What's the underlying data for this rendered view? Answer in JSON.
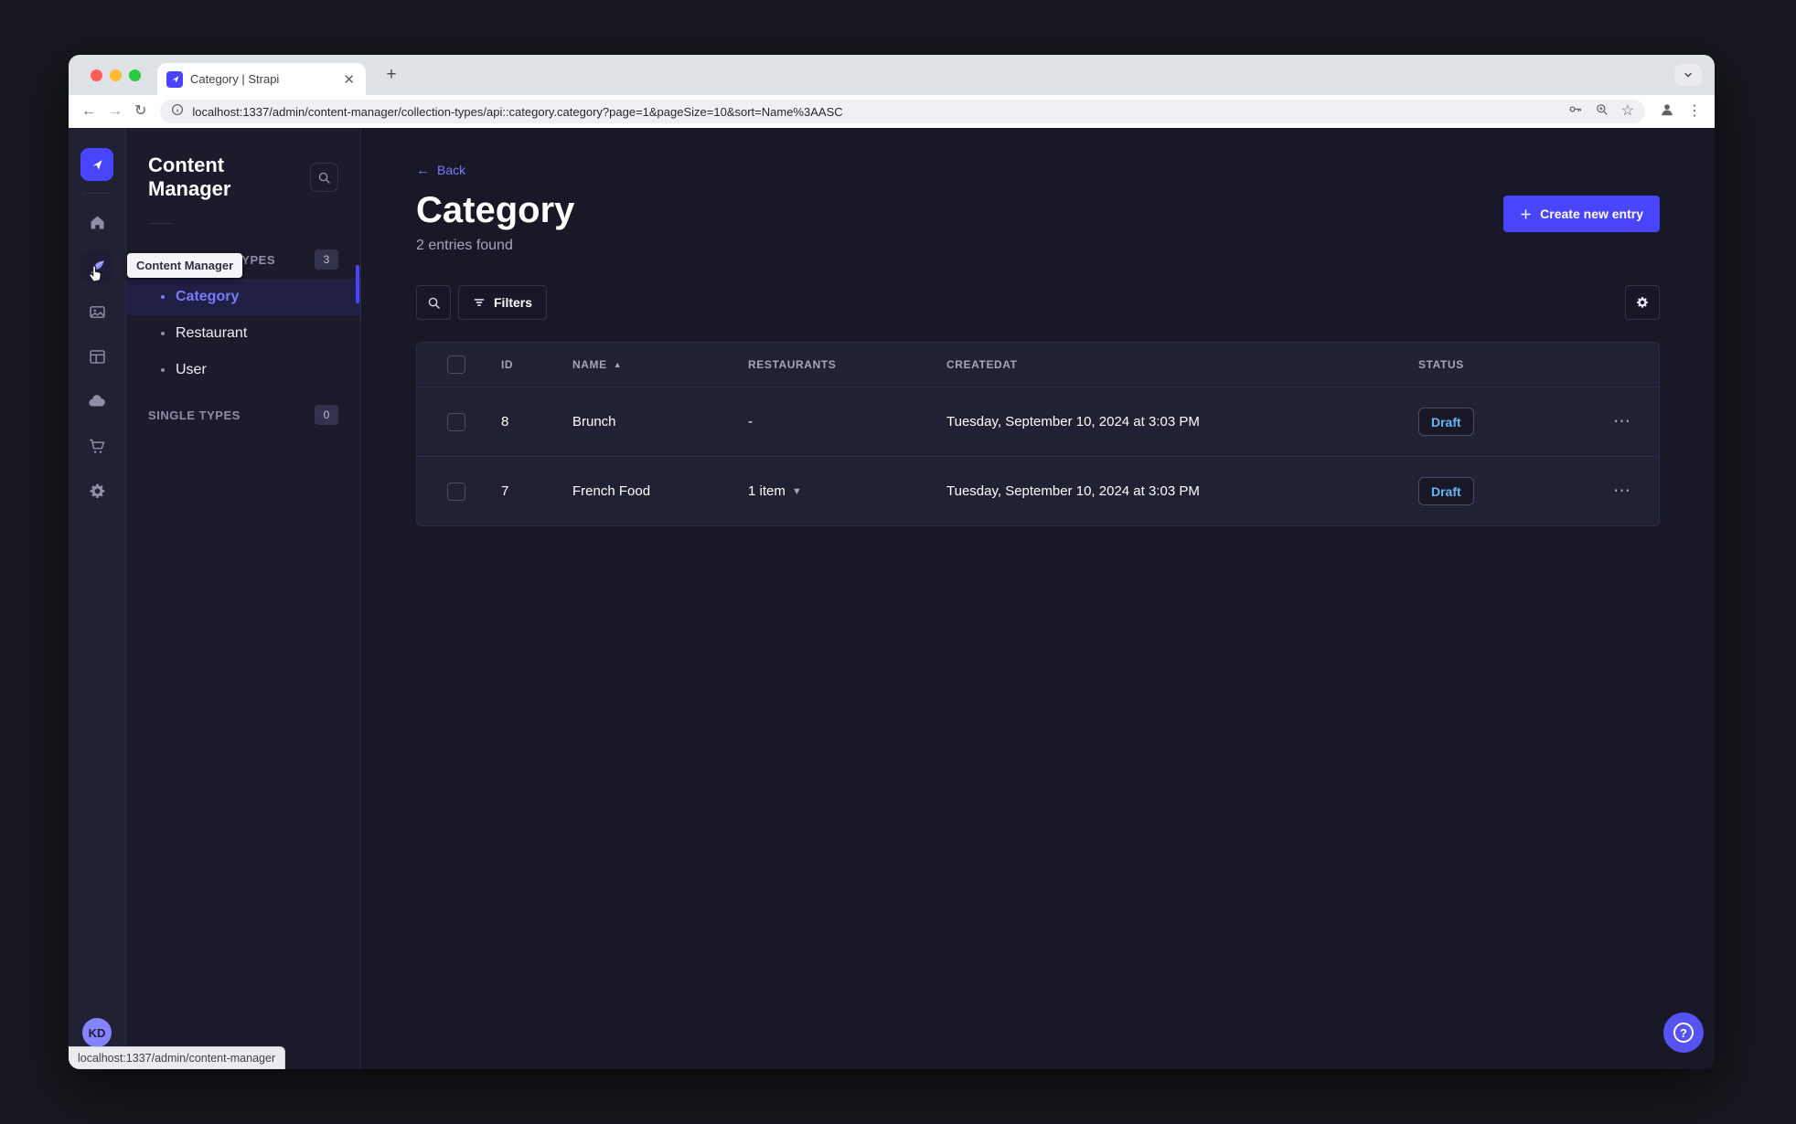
{
  "browser": {
    "tab_title": "Category | Strapi",
    "url": "localhost:1337/admin/content-manager/collection-types/api::category.category?page=1&pageSize=10&sort=Name%3AASC",
    "status_tooltip": "localhost:1337/admin/content-manager"
  },
  "nav": {
    "tooltip": "Content Manager",
    "avatar_initials": "KD",
    "icons": [
      {
        "name": "home-icon",
        "active": false
      },
      {
        "name": "content-manager-icon",
        "active": true
      },
      {
        "name": "media-library-icon",
        "active": false
      },
      {
        "name": "content-type-builder-icon",
        "active": false
      },
      {
        "name": "deploy-cloud-icon",
        "active": false
      },
      {
        "name": "marketplace-icon",
        "active": false
      },
      {
        "name": "settings-icon",
        "active": false
      }
    ]
  },
  "subnav": {
    "title": "Content Manager",
    "sections": [
      {
        "label": "COLLECTION TYPES",
        "badge": "3",
        "items": [
          {
            "label": "Category",
            "active": true
          },
          {
            "label": "Restaurant",
            "active": false
          },
          {
            "label": "User",
            "active": false
          }
        ]
      },
      {
        "label": "SINGLE TYPES",
        "badge": "0",
        "items": []
      }
    ]
  },
  "main": {
    "back_label": "Back",
    "title": "Category",
    "subtitle": "2 entries found",
    "create_button_label": "Create new entry",
    "filters_button_label": "Filters",
    "table": {
      "columns": [
        "ID",
        "NAME",
        "RESTAURANTS",
        "CREATEDAT",
        "STATUS"
      ],
      "sorted_column": "NAME",
      "sort_direction": "ascending",
      "rows": [
        {
          "id": "8",
          "name": "Brunch",
          "restaurants": "-",
          "createdat": "Tuesday, September 10, 2024 at 3:03 PM",
          "status": "Draft"
        },
        {
          "id": "7",
          "name": "French Food",
          "restaurants": "1 item",
          "createdat": "Tuesday, September 10, 2024 at 3:03 PM",
          "status": "Draft"
        }
      ]
    }
  },
  "colors": {
    "primary": "#4945ff",
    "primary_light": "#7b79ff",
    "draft_status": "#66b7f1",
    "app_background": "#181826",
    "surface": "#212134"
  }
}
